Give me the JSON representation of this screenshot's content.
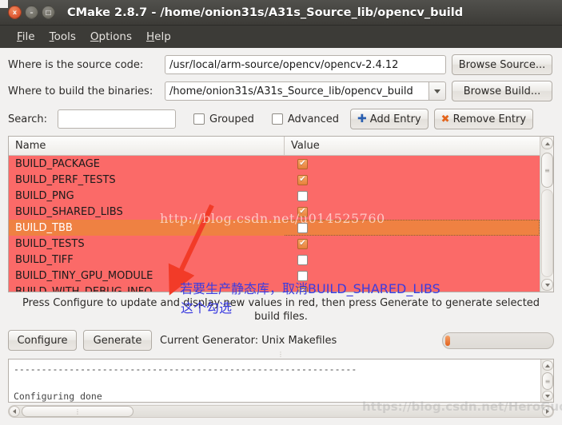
{
  "window": {
    "title": "CMake 2.8.7 - /home/onion31s/A31s_Source_lib/opencv_build",
    "buttons": {
      "close": "x",
      "minimize": "–",
      "maximize": "□"
    }
  },
  "menubar": {
    "items": [
      {
        "label": "File"
      },
      {
        "label": "Tools"
      },
      {
        "label": "Options"
      },
      {
        "label": "Help"
      }
    ]
  },
  "paths": {
    "source_label": "Where is the source code:",
    "source_value": "/usr/local/arm-source/opencv/opencv-2.4.12",
    "browse_source_label": "Browse Source...",
    "build_label": "Where to build the binaries:",
    "build_value": "/home/onion31s/A31s_Source_lib/opencv_build",
    "browse_build_label": "Browse Build..."
  },
  "search": {
    "label": "Search:",
    "value": "",
    "placeholder": "",
    "grouped_label": "Grouped",
    "grouped_checked": false,
    "advanced_label": "Advanced",
    "advanced_checked": false,
    "add_entry_label": "Add Entry",
    "remove_entry_label": "Remove Entry"
  },
  "cache_table": {
    "columns": [
      "Name",
      "Value"
    ],
    "rows": [
      {
        "name": "BUILD_PACKAGE",
        "checked": true,
        "selected": false
      },
      {
        "name": "BUILD_PERF_TESTS",
        "checked": true,
        "selected": false
      },
      {
        "name": "BUILD_PNG",
        "checked": false,
        "selected": false
      },
      {
        "name": "BUILD_SHARED_LIBS",
        "checked": true,
        "selected": false
      },
      {
        "name": "BUILD_TBB",
        "checked": false,
        "selected": true
      },
      {
        "name": "BUILD_TESTS",
        "checked": true,
        "selected": false
      },
      {
        "name": "BUILD_TIFF",
        "checked": false,
        "selected": false
      },
      {
        "name": "BUILD_TINY_GPU_MODULE",
        "checked": false,
        "selected": false
      },
      {
        "name": "BUILD_WITH_DEBUG_INFO",
        "checked": true,
        "selected": false
      }
    ]
  },
  "hint": "Press Configure to update and display new values in red, then press Generate to generate selected build files.",
  "actions": {
    "configure_label": "Configure",
    "generate_label": "Generate",
    "generator_status": "Current Generator: Unix Makefiles",
    "progress_percent": 3
  },
  "log": {
    "lines": [
      "--------------------------------------------------------------",
      "",
      "Configuring done"
    ]
  },
  "annotations": {
    "note_line1": "若要生产静态库，取消BUILD_SHARED_LIBS",
    "note_line2": "这个勾选",
    "watermark_top": "http://blog.csdn.net/u014525760",
    "watermark_bottom": "https://blog.csdn.net/HeroGuo"
  },
  "colors": {
    "row_modified": "#fb6a68",
    "row_selected": "#ef8142",
    "checkbox_on": "#e8803a",
    "annotation": "#3b3ce0",
    "arrow": "#f23b28",
    "titlebar": "#3c3b37"
  }
}
